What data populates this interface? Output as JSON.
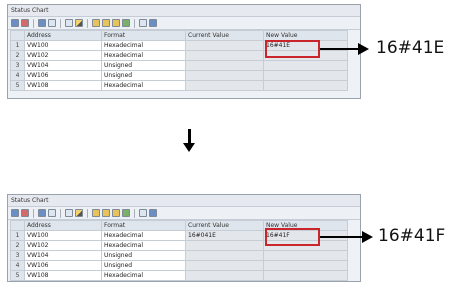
{
  "top": {
    "window_title": "Status Chart",
    "columns": [
      "Address",
      "Format",
      "Current Value",
      "New Value"
    ],
    "rows": [
      {
        "num": "1",
        "address": "VW100",
        "format": "Hexadecimal",
        "current": "",
        "new": "16#41E"
      },
      {
        "num": "2",
        "address": "VW102",
        "format": "Hexadecimal",
        "current": "",
        "new": ""
      },
      {
        "num": "3",
        "address": "VW104",
        "format": "Unsigned",
        "current": "",
        "new": ""
      },
      {
        "num": "4",
        "address": "VW106",
        "format": "Unsigned",
        "current": "",
        "new": ""
      },
      {
        "num": "5",
        "address": "VW108",
        "format": "Hexadecimal",
        "current": "",
        "new": ""
      }
    ],
    "callout": "16#41E"
  },
  "bottom": {
    "window_title": "Status Chart",
    "columns": [
      "Address",
      "Format",
      "Current Value",
      "New Value"
    ],
    "rows": [
      {
        "num": "1",
        "address": "VW100",
        "format": "Hexadecimal",
        "current": "16#041E",
        "new": "16#41F"
      },
      {
        "num": "2",
        "address": "VW102",
        "format": "Hexadecimal",
        "current": "",
        "new": ""
      },
      {
        "num": "3",
        "address": "VW104",
        "format": "Unsigned",
        "current": "",
        "new": ""
      },
      {
        "num": "4",
        "address": "VW106",
        "format": "Unsigned",
        "current": "",
        "new": ""
      },
      {
        "num": "5",
        "address": "VW108",
        "format": "Hexadecimal",
        "current": "",
        "new": ""
      }
    ],
    "callout": "16#41F"
  },
  "toolbar_icons": [
    "chart-icon",
    "delete-icon",
    "table-icon",
    "grid-icon",
    "read-icon",
    "write-icon",
    "force-icon",
    "unforce-icon",
    "folder-icon",
    "trend-icon",
    "insert-row-icon",
    "options-icon"
  ],
  "colors": {
    "highlight": "#c9252b",
    "arrow": "#000000"
  }
}
